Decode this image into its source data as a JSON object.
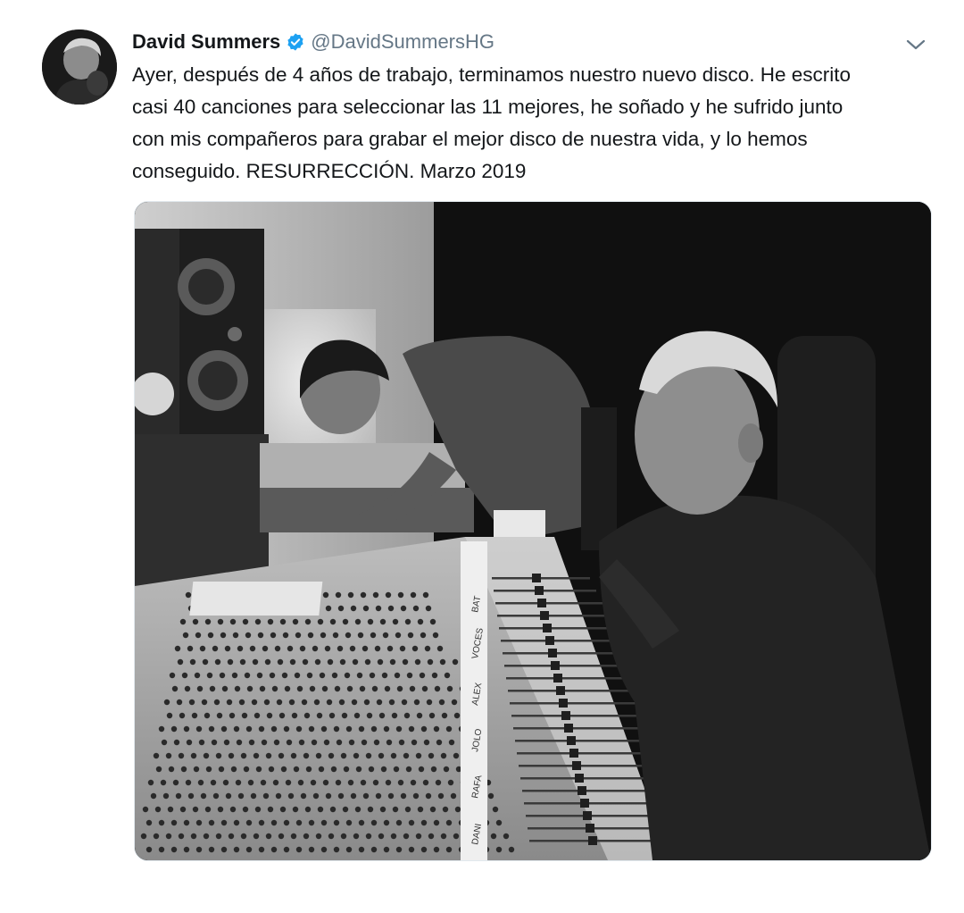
{
  "tweet": {
    "author_name": "David Summers",
    "author_handle": "@DavidSummersHG",
    "verified": true,
    "text_lines": [
      "Ayer, después de 4 años de trabajo, terminamos nuestro nuevo disco. He escrito",
      "casi 40 canciones para seleccionar las 11 mejores, he soñado y he sufrido junto",
      "con mis compañeros para grabar el mejor disco de nuestra vida, y lo hemos",
      "conseguido. RESURRECCIÓN. Marzo 2019"
    ]
  },
  "colors": {
    "text": "#14171a",
    "secondary": "#657786",
    "verified_badge": "#1da1f2"
  },
  "icons": {
    "verified": "verified-badge-icon",
    "menu": "chevron-down-icon"
  },
  "media": {
    "scribble_strip_labels": [
      "DANI",
      "RAFA",
      "JOLO",
      "ALEX",
      "VOCES",
      "BAT"
    ]
  }
}
